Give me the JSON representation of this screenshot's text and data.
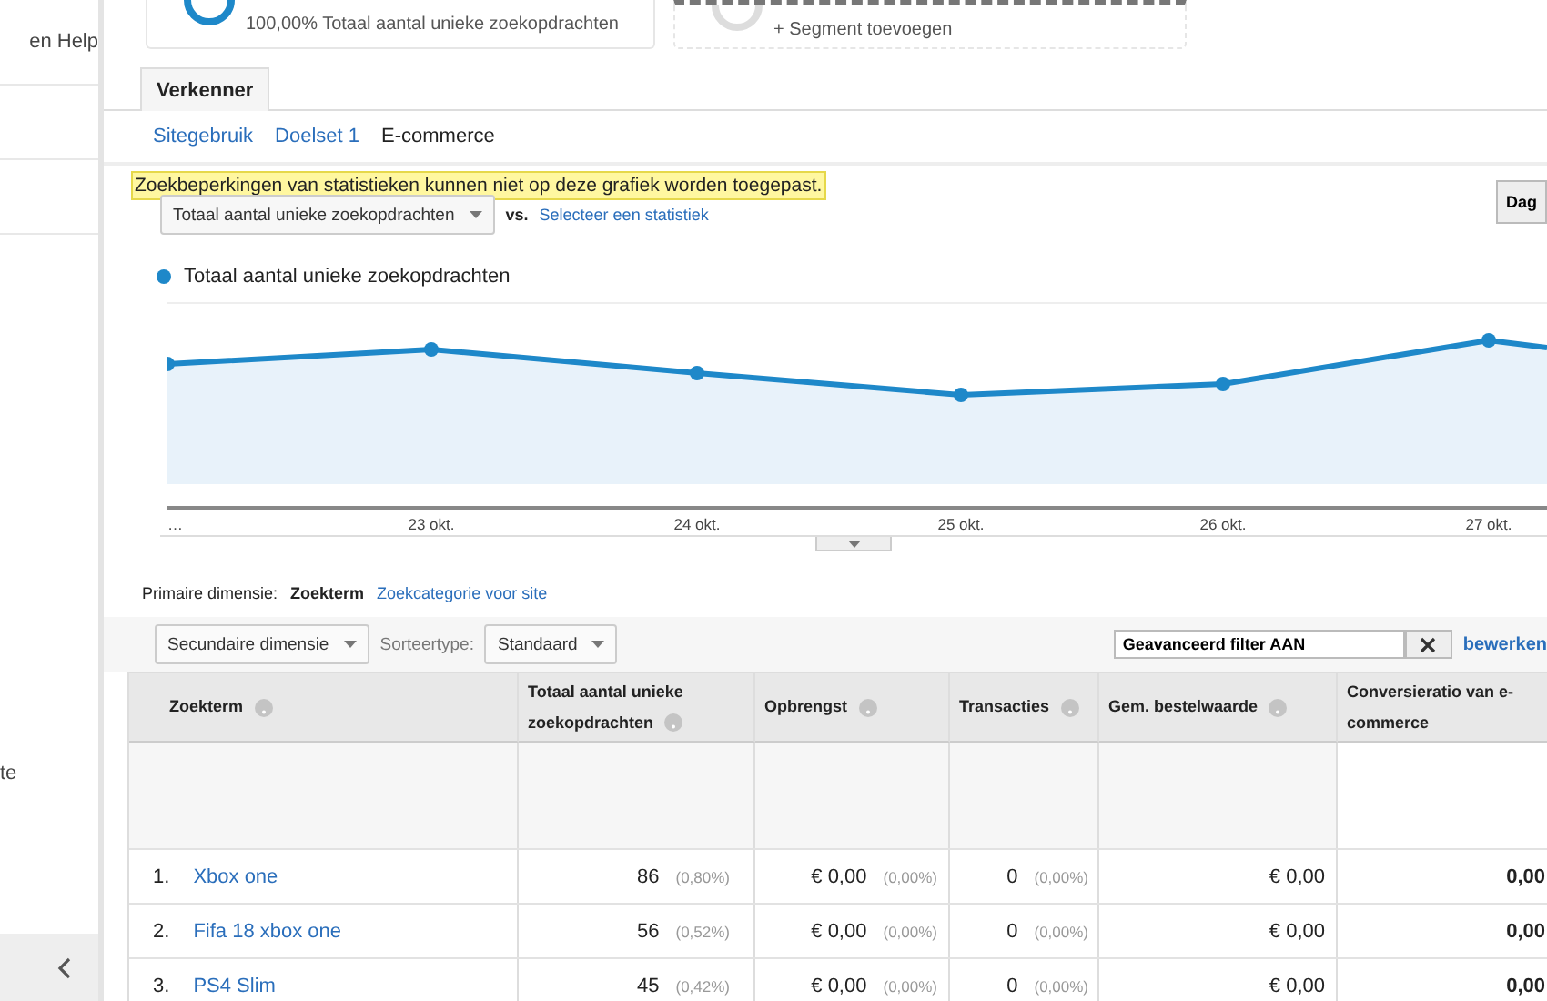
{
  "sidebar": {
    "items": [
      "en Help",
      "te"
    ]
  },
  "segments": [
    {
      "kind": "active",
      "label": "100,00% Totaal aantal unieke zoekopdrachten"
    },
    {
      "kind": "add",
      "label": "+ Segment toevoegen"
    }
  ],
  "tabs": [
    {
      "label": "Verkenner",
      "selected": true
    }
  ],
  "subtabs": [
    {
      "label": "Sitegebruik",
      "selected": false
    },
    {
      "label": "Doelset 1",
      "selected": false
    },
    {
      "label": "E-commerce",
      "selected": true
    }
  ],
  "notice": "Zoekbeperkingen van statistieken kunnen niet op deze grafiek worden toegepast.",
  "metric_select": "Totaal aantal unieke zoekopdrachten",
  "vs": "vs.",
  "compare_link": "Selecteer een statistiek",
  "period_button": "Dag",
  "chart": {
    "legend": "Totaal aantal unieke zoekopdrachten",
    "x_labels": [
      "…",
      "23 okt.",
      "24 okt.",
      "25 okt.",
      "26 okt.",
      "27 okt."
    ]
  },
  "primary_dimension": {
    "label": "Primaire dimensie:",
    "options": [
      {
        "label": "Zoekterm",
        "selected": true
      },
      {
        "label": "Zoekcategorie voor site",
        "selected": false
      }
    ]
  },
  "toolbar": {
    "secondary": "Secundaire dimensie",
    "sort_label": "Sorteertype:",
    "sort_value": "Standaard",
    "filter_value": "Geavanceerd filter AAN",
    "edit_link": "bewerken"
  },
  "table": {
    "columns": [
      {
        "label": "Zoekterm",
        "help": true
      },
      {
        "label": "Totaal aantal unieke zoekopdrachten",
        "help": true
      },
      {
        "label": "Opbrengst",
        "help": true
      },
      {
        "label": "Transacties",
        "help": true
      },
      {
        "label": "Gem. bestelwaarde",
        "help": true
      },
      {
        "label": "Conversieratio van e-commerce",
        "help": false
      }
    ],
    "rows": [
      {
        "index": "1.",
        "term": "Xbox one",
        "searches": "86",
        "searches_share": "(0,80%)",
        "revenue": "€ 0,00",
        "revenue_share": "(0,00%)",
        "transactions": "0",
        "transactions_share": "(0,00%)",
        "avg_order": "€ 0,00",
        "conversion": "0,00"
      },
      {
        "index": "2.",
        "term": "Fifa 18 xbox one",
        "searches": "56",
        "searches_share": "(0,52%)",
        "revenue": "€ 0,00",
        "revenue_share": "(0,00%)",
        "transactions": "0",
        "transactions_share": "(0,00%)",
        "avg_order": "€ 0,00",
        "conversion": "0,00"
      },
      {
        "index": "3.",
        "term": "PS4 Slim",
        "searches": "45",
        "searches_share": "(0,42%)",
        "revenue": "€ 0,00",
        "revenue_share": "(0,00%)",
        "transactions": "0",
        "transactions_share": "(0,00%)",
        "avg_order": "€ 0,00",
        "conversion": "0,00"
      }
    ]
  }
}
